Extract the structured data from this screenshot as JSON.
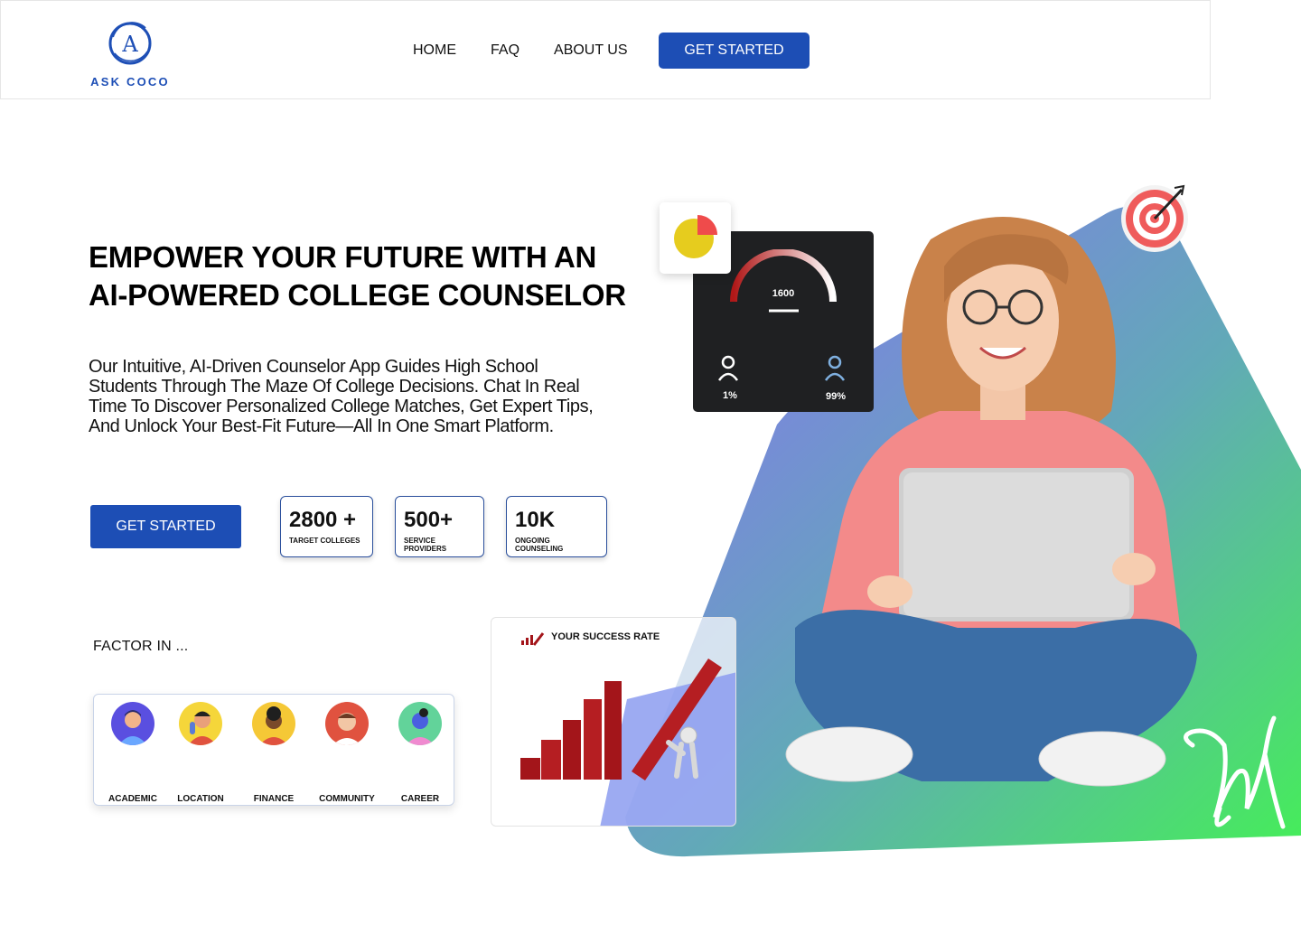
{
  "brand": {
    "name": "ASK COCO",
    "logo_letter": "A",
    "accent": "#1d4eb5"
  },
  "nav": {
    "items": [
      "HOME",
      "FAQ",
      "ABOUT US"
    ],
    "cta_label": "GET STARTED"
  },
  "hero": {
    "headline_line1": "EMPOWER YOUR FUTURE WITH AN",
    "headline_line2": "AI-POWERED COLLEGE COUNSELOR",
    "description": "Our Intuitive, AI-Driven Counselor App Guides High School Students Through The Maze Of College Decisions. Chat In Real Time To Discover Personalized College Matches, Get Expert Tips, And Unlock Your Best-Fit Future—All In One Smart Platform.",
    "cta_label": "GET STARTED"
  },
  "stats": [
    {
      "value": "2800 +",
      "label": "TARGET COLLEGES"
    },
    {
      "value": "500+",
      "label": "SERVICE PROVIDERS"
    },
    {
      "value": "10K",
      "label": "ONGOING COUNSELING"
    }
  ],
  "factors": {
    "title": "FACTOR IN ...",
    "items": [
      {
        "label": "ACADEMIC",
        "color": "#5a4fe0"
      },
      {
        "label": "LOCATION",
        "color": "#f5d63a"
      },
      {
        "label": "FINANCE",
        "color": "#f5c836"
      },
      {
        "label": "COMMUNITY",
        "color": "#e0523f"
      },
      {
        "label": "CAREER",
        "color": "#62d39a"
      }
    ]
  },
  "dashboard_card": {
    "gauge_value": "1600",
    "left_pct": "1%",
    "right_pct": "99%"
  },
  "success_card": {
    "title": "YOUR SUCCESS RATE"
  },
  "colors": {
    "gradient_start": "#7b83ef",
    "gradient_end": "#45ea5c",
    "bar_red": "#a3151a",
    "hoodie": "#f38a8a",
    "jeans": "#3b6ea6"
  }
}
